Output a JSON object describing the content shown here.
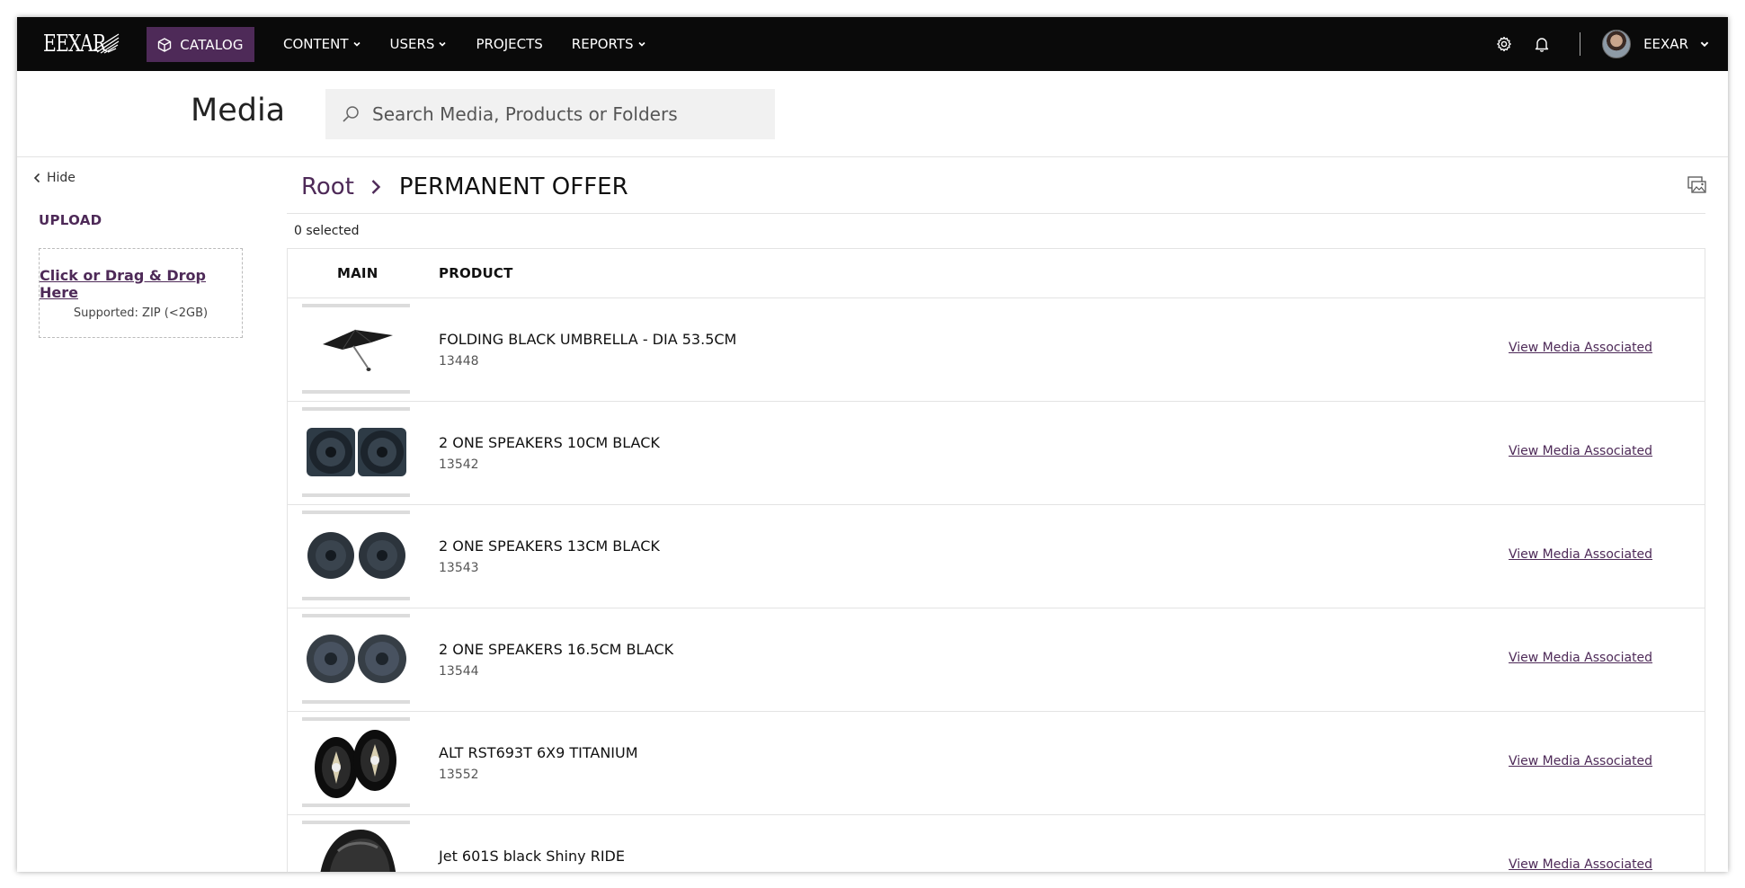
{
  "brand": {
    "logo_text": "EEXAR",
    "accent": "#4e2a58",
    "topbar_bg": "#0a0a0a"
  },
  "nav": {
    "catalog_label": "CATALOG",
    "items": [
      {
        "label": "CONTENT",
        "has_dropdown": true
      },
      {
        "label": "USERS",
        "has_dropdown": true
      },
      {
        "label": "PROJECTS",
        "has_dropdown": false
      },
      {
        "label": "REPORTS",
        "has_dropdown": true
      }
    ],
    "icons": [
      "gear-icon",
      "bell-icon",
      "avatar",
      "chevron-down-icon"
    ],
    "user_name": "EEXAR"
  },
  "header": {
    "title": "Media",
    "search_placeholder": "Search Media, Products or Folders"
  },
  "sidebar": {
    "hide_label": "Hide",
    "upload_title": "UPLOAD",
    "drop_link": "Click or Drag & Drop Here",
    "drop_hint": "Supported: ZIP (<2GB)"
  },
  "main": {
    "breadcrumb": {
      "root": "Root",
      "current": "PERMANENT OFFER"
    },
    "selected_count": "0 selected",
    "columns": {
      "main": "MAIN",
      "product": "PRODUCT"
    },
    "rows": [
      {
        "name": "FOLDING BLACK UMBRELLA - DIA 53.5CM",
        "sku": "13448",
        "link": "View Media Associated",
        "thumb": "umbrella"
      },
      {
        "name": "2 ONE SPEAKERS 10CM BLACK",
        "sku": "13542",
        "link": "View Media Associated",
        "thumb": "speakers"
      },
      {
        "name": "2 ONE SPEAKERS 13CM BLACK",
        "sku": "13543",
        "link": "View Media Associated",
        "thumb": "speakers"
      },
      {
        "name": "2 ONE SPEAKERS 16.5CM BLACK",
        "sku": "13544",
        "link": "View Media Associated",
        "thumb": "speakers"
      },
      {
        "name": "ALT RST693T 6X9 TITANIUM",
        "sku": "13552",
        "link": "View Media Associated",
        "thumb": "oval-speakers"
      },
      {
        "name": "Jet 601S black Shiny RIDE",
        "sku": "",
        "link": "View Media Associated",
        "thumb": "helmet"
      }
    ]
  }
}
